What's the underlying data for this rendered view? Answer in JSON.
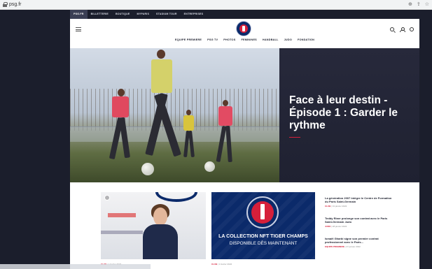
{
  "browser": {
    "url": "psg.fr"
  },
  "top_nav": [
    {
      "label": "PSG.FR",
      "active": true
    },
    {
      "label": "BILLETTERIE",
      "active": false
    },
    {
      "label": "BOUTIQUE",
      "active": false
    },
    {
      "label": "MYPARIS",
      "active": false
    },
    {
      "label": "STADIUM TOUR",
      "active": false
    },
    {
      "label": "ENTREPRISES",
      "active": false
    }
  ],
  "main_nav": [
    "EQUIPE PREMIERE",
    "PSG TV",
    "PHOTOS",
    "FEMININES",
    "HANDBALL",
    "JUDO",
    "FONDATION"
  ],
  "hero": {
    "title": "Face à leur destin - Épisode 1 : Garder le rythme"
  },
  "cards": [
    {
      "category": "CLUB",
      "date": "1 février 2022"
    },
    {
      "line1": "LA COLLECTION NFT TIGER CHAMPS",
      "line2": "DISPONIBLE DÈS MAINTENANT",
      "category": "CLUB",
      "date": "1 février 2022"
    }
  ],
  "side_news": [
    {
      "title": "La génération 2007 intègre le Centre de Formation du Paris Saint-Germain",
      "category": "CLUB",
      "date": "31 janvier 2022"
    },
    {
      "title": "Teddy Riner prolonge son contrat avec le Paris Saint-Germain Judo",
      "category": "JUDO",
      "date": "28 janvier 2022"
    },
    {
      "title": "Ismaël Gharbi signe son premier contrat professionnel avec le Paris...",
      "category": "EQUIPE PREMIERE",
      "date": "27 janvier 2022"
    }
  ],
  "colors": {
    "navy": "#0b2a6a",
    "red": "#d61f3a",
    "dark_bg": "#1b1e2c"
  }
}
